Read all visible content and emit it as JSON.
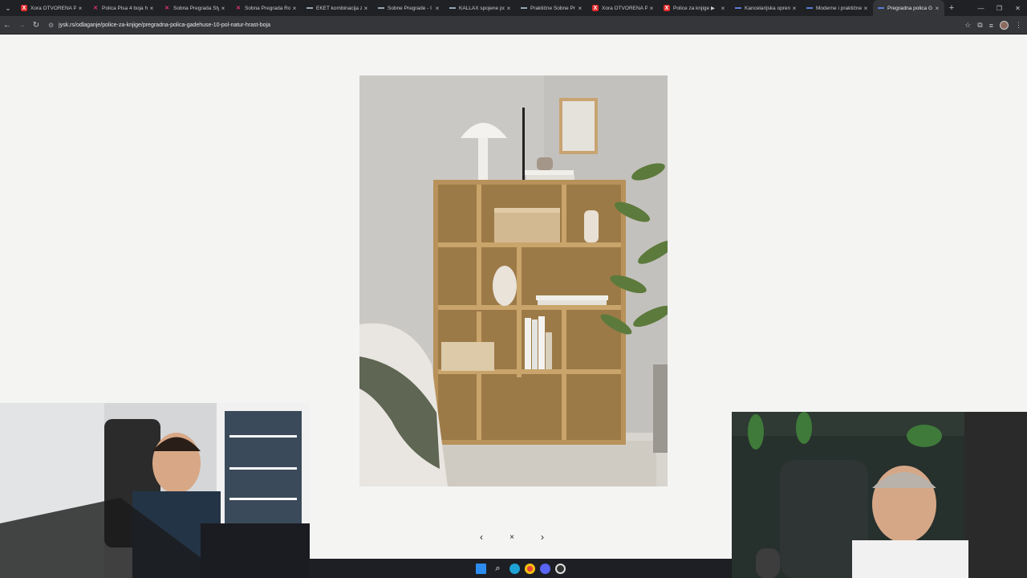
{
  "tabs": [
    {
      "label": "Xora OTVORENA Po",
      "favicon": "red-x-icon"
    },
    {
      "label": "Polica Pisa 4 boja h",
      "favicon": "pink-x-icon"
    },
    {
      "label": "Sobna Pregrada Sty",
      "favicon": "pink-x-icon"
    },
    {
      "label": "Sobna Pregrada Ro",
      "favicon": "pink-x-icon"
    },
    {
      "label": "EKET kombinacija z",
      "favicon": "gray-dash-icon"
    },
    {
      "label": "Sobne Pregrade - I",
      "favicon": "gray-dash-icon"
    },
    {
      "label": "KALLAX spojene po",
      "favicon": "gray-dash-icon"
    },
    {
      "label": "Praktične Sobne Pr",
      "favicon": "gray-dash-icon"
    },
    {
      "label": "Xora OTVORENA Po",
      "favicon": "red-x-icon"
    },
    {
      "label": "Police za knjige ▶ ",
      "favicon": "red-x-icon"
    },
    {
      "label": "Kancelarijska opren",
      "favicon": "blue-dash-icon"
    },
    {
      "label": "Moderne i praktične",
      "favicon": "blue-dash-icon"
    },
    {
      "label": "Pregradna polica G",
      "favicon": "blue-dash-icon",
      "active": true
    }
  ],
  "tab_close_glyph": "×",
  "new_tab_glyph": "+",
  "address_bar": {
    "url": "jysk.rs/odlaganje/police-za-knjige/pregradna-polica-gadehuse-10-pol-natur-hrast-boja"
  },
  "gallery": {
    "prev_glyph": "‹",
    "close_glyph": "×",
    "next_glyph": "›"
  },
  "colors": {
    "page_bg": "#f4f4f3",
    "tab_strip": "#202124",
    "toolbar": "#35363a",
    "shelf_wood": "#c9a46b",
    "wall": "#c9c7c3"
  }
}
